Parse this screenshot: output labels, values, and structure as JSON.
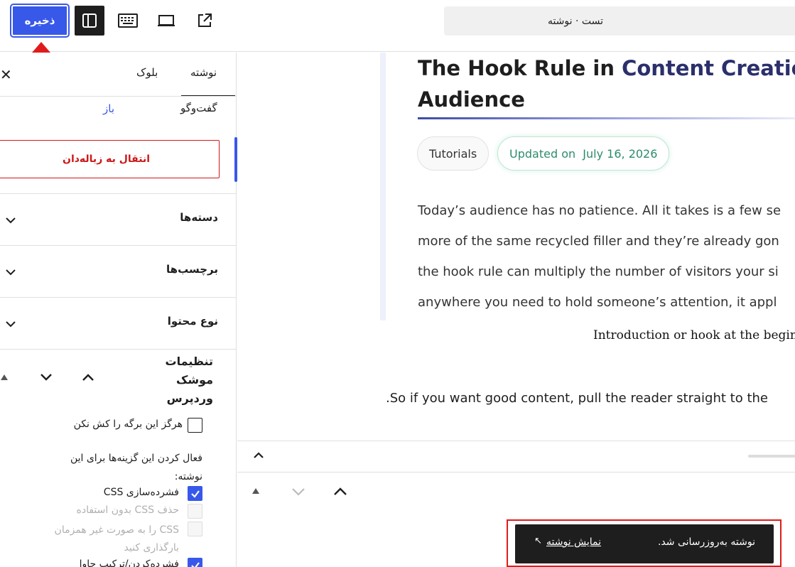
{
  "toolbar": {
    "save_label": "ذخیره",
    "sidebar_toggle_icon": "sidebar-icon",
    "keyboard_icon": "keyboard-icon",
    "preview_icon": "desktop-preview-icon",
    "external_icon": "external-link-icon",
    "document_title": "تست · نوشته"
  },
  "sidebar": {
    "tabs": [
      {
        "label": "نوشته",
        "active": true
      },
      {
        "label": "بلوک",
        "active": false
      }
    ],
    "discussion": {
      "label": "گفت‌وگو",
      "value": "باز"
    },
    "trash_label": "انتقال به زباله‌دان",
    "sections": [
      {
        "label": "دسته‌ها"
      },
      {
        "label": "برچسب‌ها"
      },
      {
        "label": "نوع محتوا"
      }
    ],
    "settings_title": [
      "تنظیمات",
      "موشک",
      "وردپرس"
    ],
    "options": {
      "never_cache": {
        "label": "هرگز این برگه را کش نکن",
        "checked": false
      },
      "enable_text": [
        "فعال کردن این گزینه‌ها برای این",
        "نوشته:"
      ],
      "minify_css": {
        "label": "فشرده‌سازی CSS",
        "checked": true
      },
      "remove_unused_css": {
        "label": "حذف CSS بدون استفاده",
        "checked": false,
        "disabled": true
      },
      "async_css": {
        "label_lines": [
          "CSS را به صورت غیر همزمان",
          "بارگذاری کنید"
        ],
        "checked": false,
        "disabled": true
      },
      "partial_label": "فشرده‌کردن/ترکیب جاوا"
    }
  },
  "post": {
    "title_part1": "The Hook Rule in ",
    "title_part2": "Content Creation",
    "title_line2": "Audience",
    "category_pill": "Tutorials",
    "updated_label": "Updated on",
    "updated_date": "July 16, 2026",
    "paragraph_lines": [
      "Today’s audience has no patience. All it takes is a few se",
      "more of the same recycled filler and they’re already gon",
      "the hook rule can multiply the number of visitors your si",
      "anywhere you need to hold someone’s attention, it appl"
    ],
    "intro_caption": "Introduction or hook at the begin",
    "closing_paragraph": ".So if you want good content, pull the reader straight to the"
  },
  "snackbar": {
    "message": "نوشته به‌روزرسانی شد.",
    "action_label": "نمایش نوشته",
    "action_icon": "arrow-up-left-icon"
  },
  "colors": {
    "accent": "#3858e9",
    "danger": "#cc1818",
    "annotation": "#e01b1b",
    "updated_green": "#2e8b6e"
  }
}
